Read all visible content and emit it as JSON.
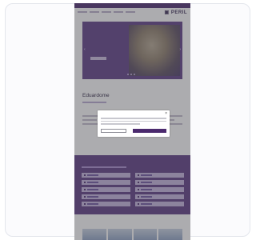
{
  "nav": {
    "logo": "▣ PERIL",
    "items": [
      "",
      "",
      "",
      "",
      ""
    ]
  },
  "hero": {
    "title": "",
    "arrow_left": "‹",
    "arrow_right": "›"
  },
  "section": {
    "title": "Eduardome"
  },
  "band": {
    "title": ""
  },
  "bottom": {
    "title": ""
  },
  "modal": {
    "title": "",
    "close": "×",
    "left_button": "",
    "right_button": ""
  },
  "colors": {
    "brand": "#4b2a6e",
    "band": "#5b3a82",
    "overlay": "rgba(70,70,78,0.45)"
  }
}
